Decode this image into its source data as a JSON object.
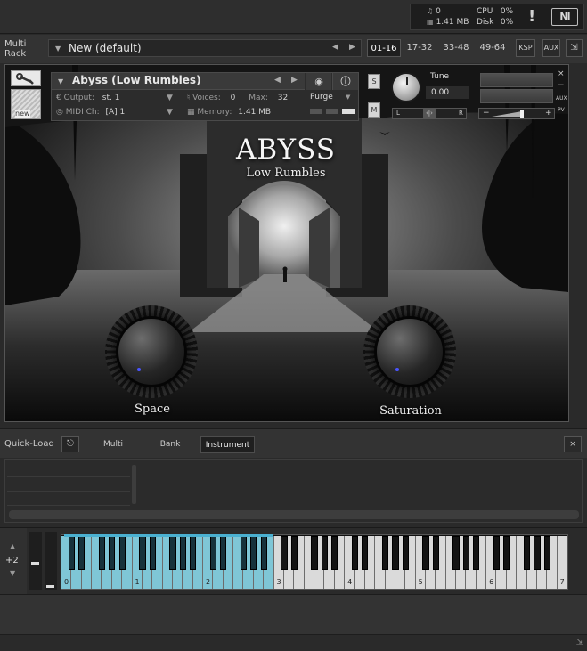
{
  "status": {
    "midi_count": "0",
    "memory": "1.41 MB",
    "cpu_label": "CPU",
    "cpu_value": "0%",
    "disk_label": "Disk",
    "disk_value": "0%",
    "warning": "!",
    "ni_logo": "NI"
  },
  "rack": {
    "label_line1": "Multi",
    "label_line2": "Rack",
    "preset_name": "New (default)",
    "tabs": [
      "01-16",
      "17-32",
      "33-48",
      "49-64"
    ],
    "active_tab": "01-16",
    "ksp_label": "KSP",
    "aux_label": "AUX"
  },
  "instrument": {
    "name": "Abyss (Low Rumbles)",
    "output_label": "Output:",
    "output_value": "st. 1",
    "voices_label": "Voices:",
    "voices_value": "0",
    "max_label": "Max:",
    "max_value": "32",
    "purge_label": "Purge",
    "midi_label": "MIDI Ch:",
    "midi_value": "[A]  1",
    "memory_label": "Memory:",
    "memory_value": "1.41 MB",
    "new_badge": "new",
    "solo_label": "S",
    "mute_label": "M",
    "tune_label": "Tune",
    "tune_value": "0.00",
    "pan_left": "L",
    "pan_right": "R",
    "pan_center": "‹|›",
    "vol_minus": "−",
    "vol_plus": "+",
    "aux_small": "AUX",
    "pv_small": "PV"
  },
  "gui": {
    "title": "ABYSS",
    "subtitle": "Low Rumbles",
    "knobs": [
      {
        "label": "Space",
        "value": 0
      },
      {
        "label": "Saturation",
        "value": 0
      }
    ]
  },
  "quickload": {
    "label": "Quick-Load",
    "tabs": [
      "Multi",
      "Bank",
      "Instrument"
    ],
    "active_tab": "Instrument",
    "close": "×"
  },
  "keyboard": {
    "octave_shift": "+2",
    "octave_labels": [
      "0",
      "1",
      "2",
      "3",
      "4",
      "5",
      "6",
      "7"
    ],
    "lit_octaves": 3
  }
}
